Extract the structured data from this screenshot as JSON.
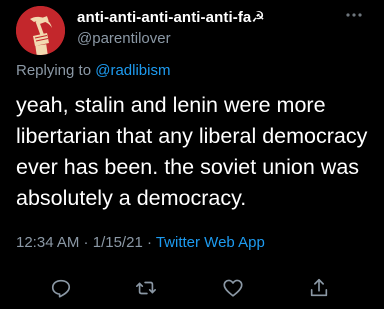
{
  "author": {
    "display_name": "anti-anti-anti-anti-anti-fa☭",
    "handle": "@parentilover",
    "avatar_icon": "hammer-and-sickle-fist-icon",
    "avatar_color": "#c3272c"
  },
  "reply": {
    "prefix": "Replying to",
    "mention": "@radlibism"
  },
  "tweet": {
    "text": "yeah, stalin and lenin were more libertarian that any liberal democracy ever has been. the soviet union was absolutely a democracy.",
    "time": "12:34 AM",
    "date": "1/15/21",
    "separator": " · ",
    "source": "Twitter Web App"
  },
  "actions": [
    {
      "name": "reply",
      "icon": "comment-icon"
    },
    {
      "name": "retweet",
      "icon": "retweet-icon"
    },
    {
      "name": "like",
      "icon": "heart-icon"
    },
    {
      "name": "share",
      "icon": "share-icon"
    }
  ],
  "colors": {
    "background": "#000000",
    "text": "#ffffff",
    "secondary": "#8b98a5",
    "accent": "#1d9bf0"
  }
}
